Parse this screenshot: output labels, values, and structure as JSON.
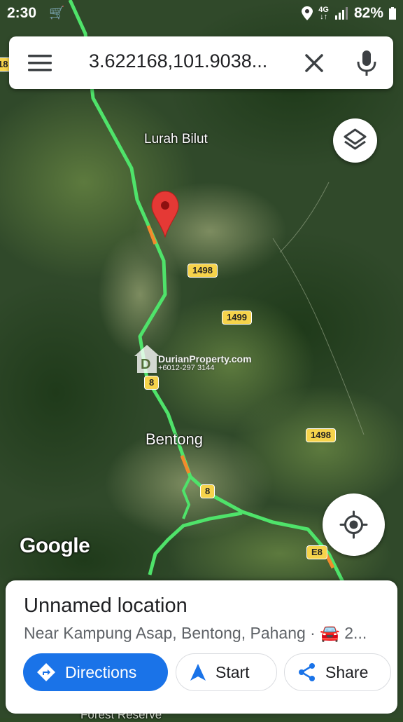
{
  "status_bar": {
    "time": "2:30",
    "network_top": "4G",
    "network_bottom": "↓↑",
    "battery": "82%"
  },
  "search": {
    "query": "3.622168,101.9038..."
  },
  "map": {
    "labels": {
      "place_1": "Lurah Bilut",
      "place_2": "Bentong",
      "edge_1": "18",
      "bottom_partial": "Forest Reserve"
    },
    "roads": [
      "1498",
      "1499",
      "8",
      "1498",
      "8",
      "E8"
    ],
    "google_logo": "Google",
    "watermark_brand": "DurianProperty.com",
    "watermark_phone": "+6012-297 3144"
  },
  "place_card": {
    "title": "Unnamed location",
    "subtitle": "Near Kampung Asap, Bentong, Pahang · 🚘 2...",
    "buttons": {
      "directions": "Directions",
      "start": "Start",
      "share": "Share"
    }
  },
  "colors": {
    "accent": "#1a73e8",
    "route": "#4fe36a",
    "pin": "#e53935"
  }
}
